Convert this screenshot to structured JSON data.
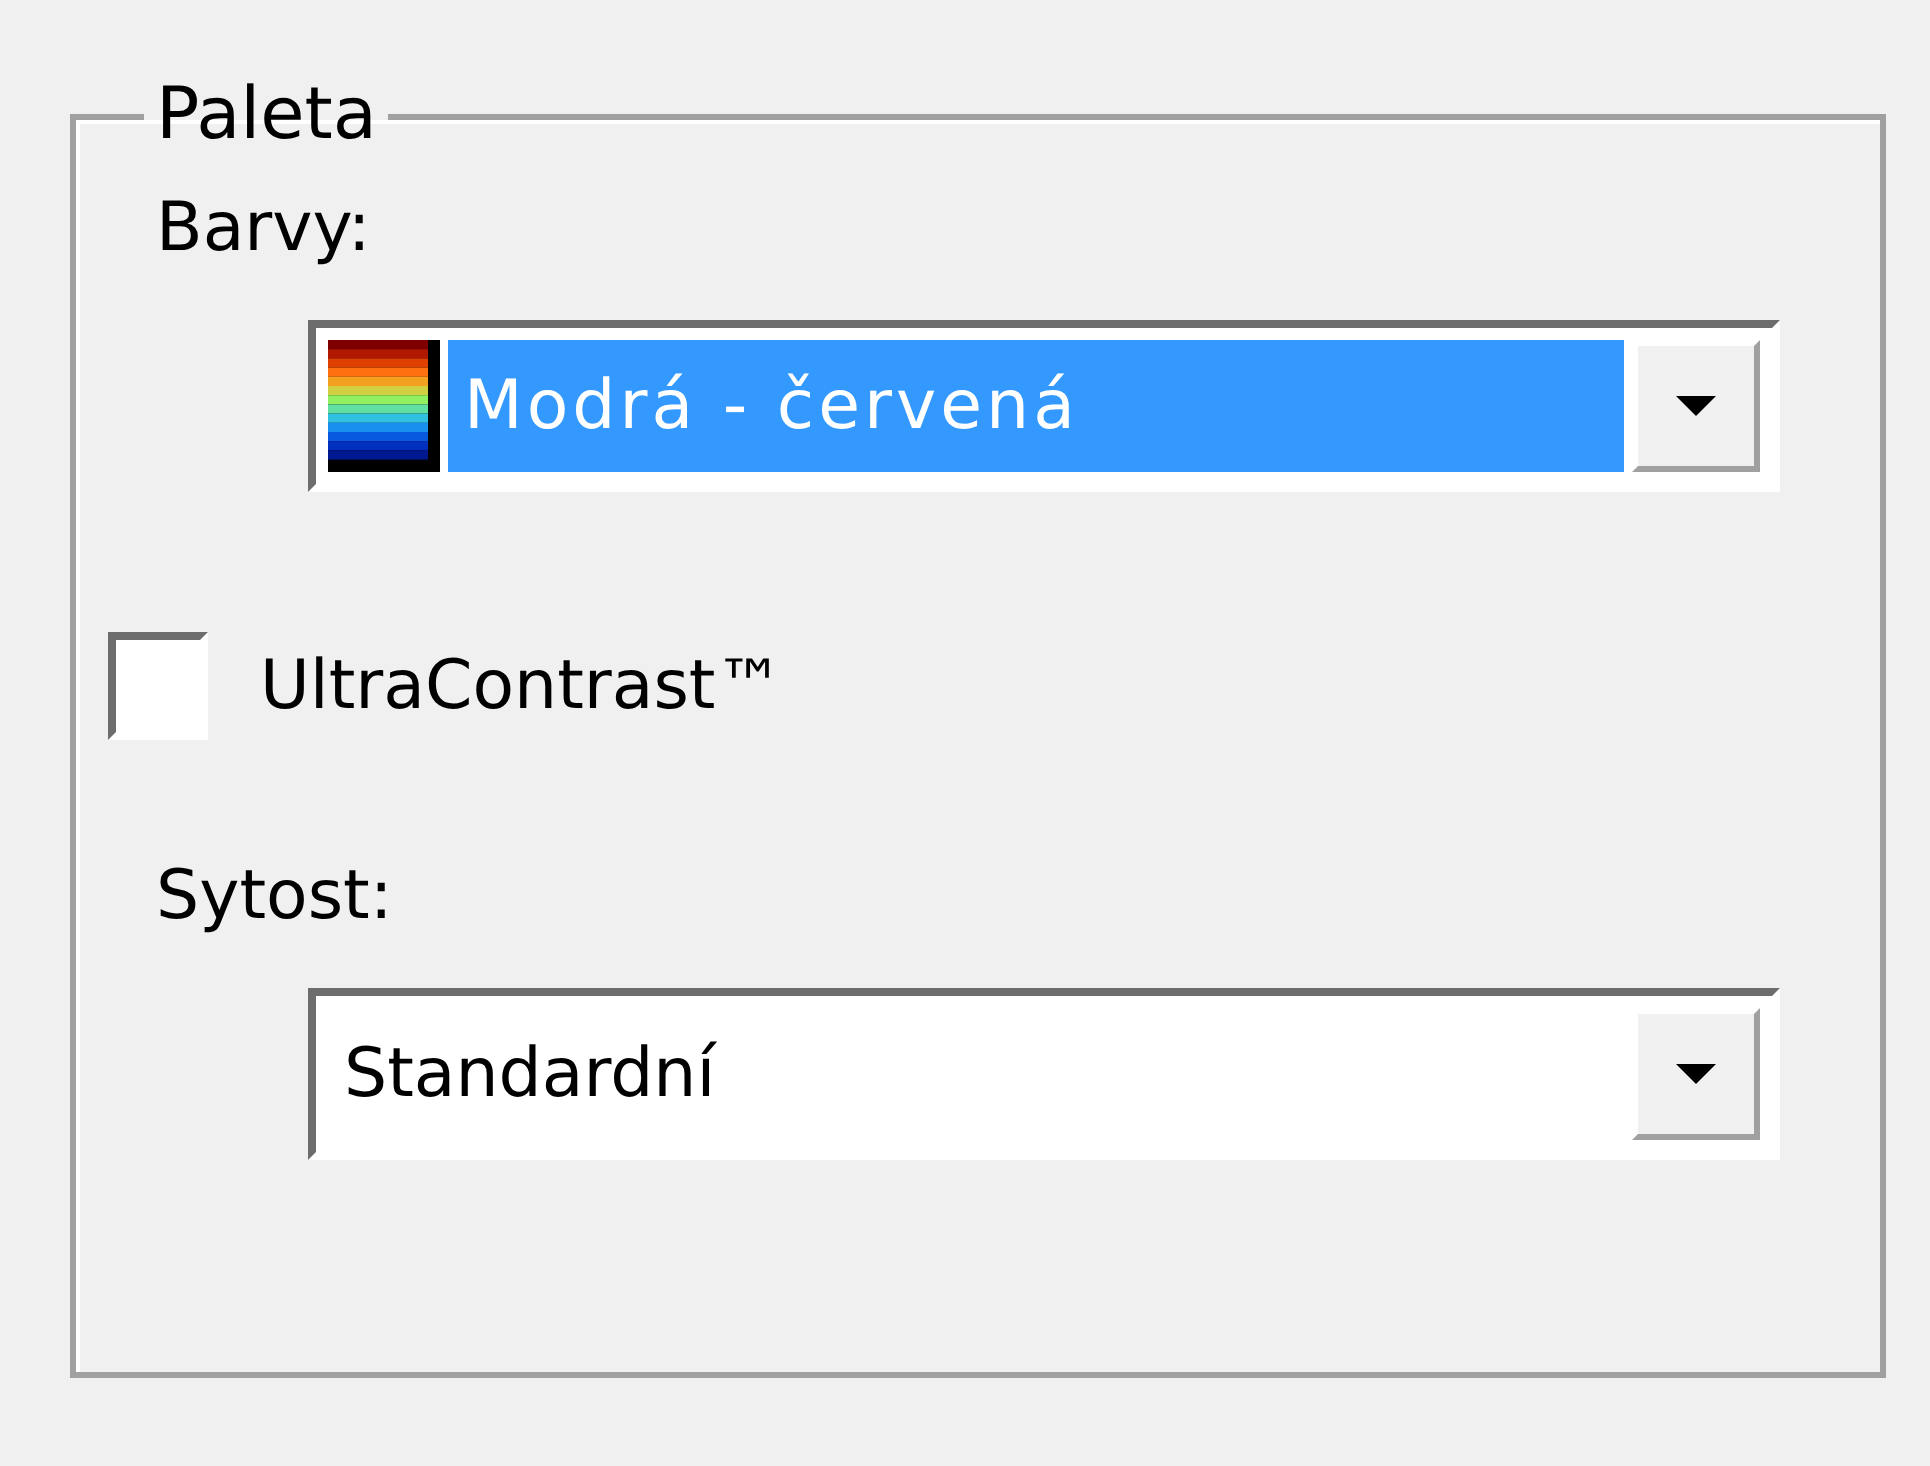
{
  "group": {
    "title": "Paleta",
    "colors_label": "Barvy:",
    "colors_combo": {
      "value": "Modrá - červená",
      "selected": true
    },
    "ultracontrast": {
      "label": "UltraContrast™",
      "checked": false
    },
    "saturation_label": "Sytost:",
    "saturation_combo": {
      "value": "Standardní",
      "selected": false
    }
  }
}
